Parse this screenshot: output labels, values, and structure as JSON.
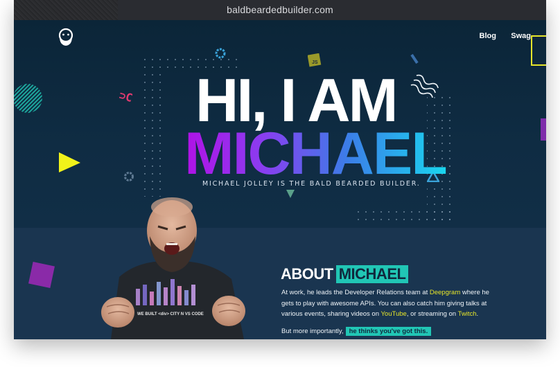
{
  "browser": {
    "url": "baldbeardedbuilder.com"
  },
  "nav": {
    "blog": "Blog",
    "swag": "Swag"
  },
  "hero": {
    "greeting": "HI, I AM",
    "name": "MICHAEL",
    "tagline": "MICHAEL JOLLEY IS THE BALD BEARDED BUILDER."
  },
  "about": {
    "title_1": "ABOUT",
    "title_2": "MICHAEL",
    "p1_a": "At work, he leads the Developer Relations team at ",
    "p1_link1": "Deepgram",
    "p1_b": " where he gets to play with awesome APIs. You can also catch him giving talks at various events, sharing videos on ",
    "p1_link2": "YouTube",
    "p1_c": ", or streaming on ",
    "p1_link3": "Twitch",
    "p1_d": ".",
    "p2": "But more importantly,",
    "p2_badge": "he thinks you've got this."
  },
  "shirt_text": "WE BUILT <div> CITY N VS CODE",
  "colors": {
    "accent_teal": "#21c6b5",
    "link_yellow": "#e6e52a",
    "hero_bg": "#0f2c43",
    "name_gradient_start": "#b012e6",
    "name_gradient_end": "#19d6ef"
  },
  "icons": [
    "bearded-man-logo-icon",
    "js-badge-icon",
    "triangle-yellow-icon",
    "wave-lines-icon",
    "gear-icon"
  ]
}
